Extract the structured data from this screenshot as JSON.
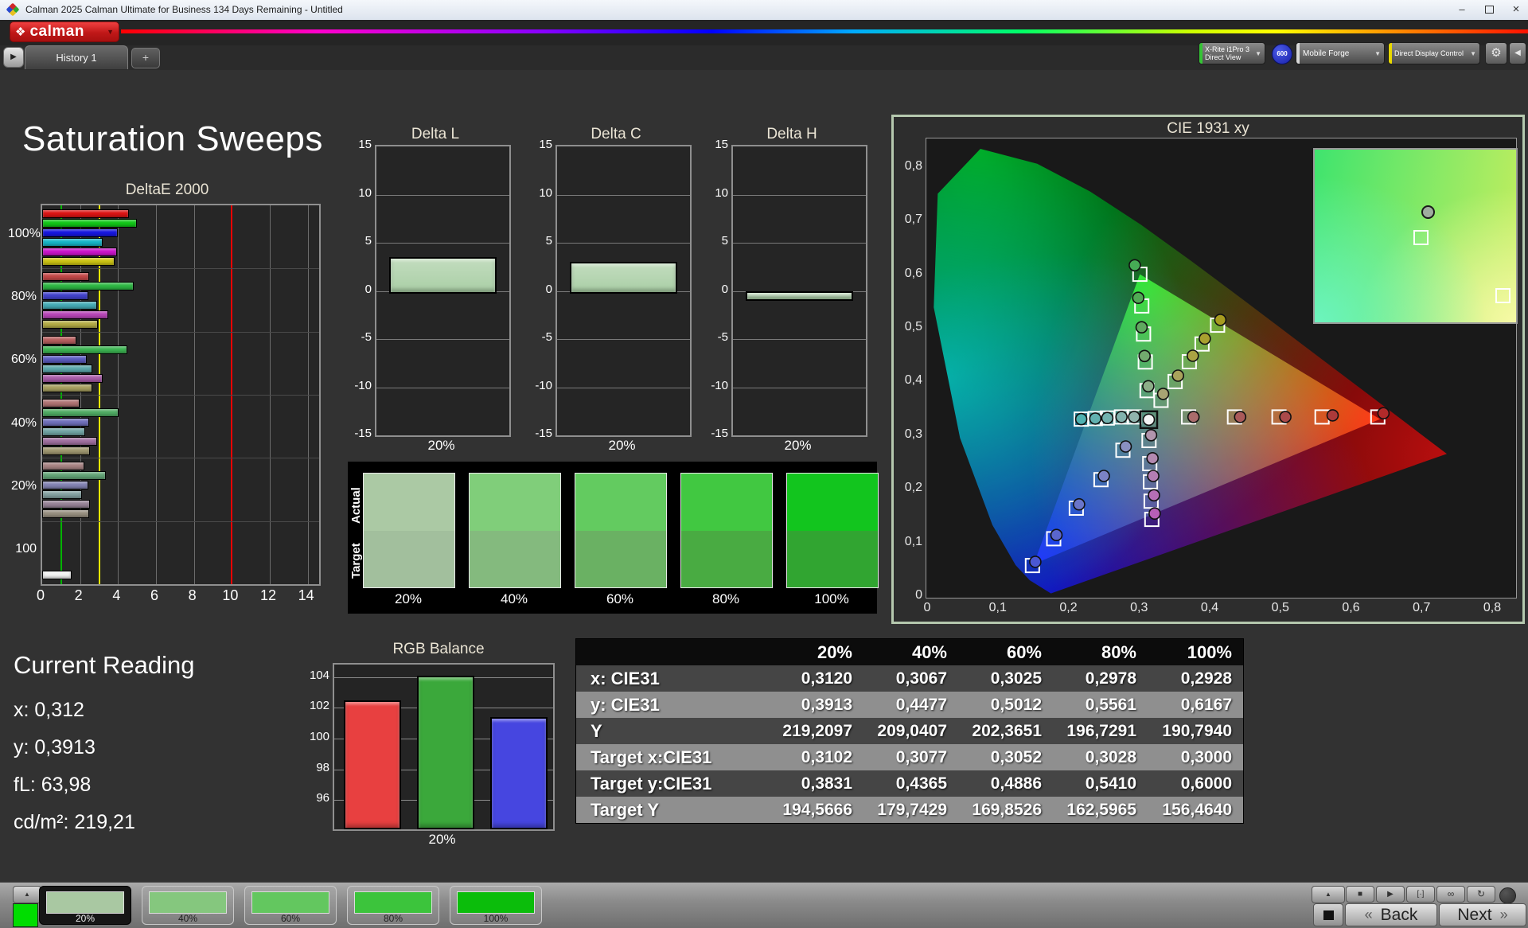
{
  "window": {
    "title": "Calman 2025 Calman Ultimate for Business 134 Days Remaining  - Untitled",
    "minimize": "–",
    "close": "×",
    "icons": [
      "app-icon",
      "minimize",
      "maximize",
      "close"
    ]
  },
  "brand": {
    "name": "calman",
    "diamond": "❖",
    "dropdown": "▼"
  },
  "toolbar": {
    "history_play": "▶",
    "tab": "History 1",
    "add": "+",
    "meter": {
      "line1": "X-Rite i1Pro 3",
      "line2": "Direct View",
      "accent": "#35c435"
    },
    "badge": "600",
    "source": {
      "label": "Mobile Forge",
      "accent": "#d8d8d8"
    },
    "control": {
      "label": "Direct Display Control",
      "accent": "#e8d800"
    },
    "gear": "⚙",
    "collapse": "◀"
  },
  "page": {
    "title": "Saturation Sweeps"
  },
  "current_reading": {
    "title": "Current Reading",
    "x": "x: 0,312",
    "y": "y: 0,3913",
    "fl": "fL: 63,98",
    "cdm2": "cd/m²: 219,21"
  },
  "swatch_compare": {
    "row_labels": [
      "Actual",
      "Target"
    ],
    "labels": [
      "20%",
      "40%",
      "60%",
      "80%",
      "100%"
    ],
    "actual": [
      "#abc9a4",
      "#80ce7a",
      "#63cb60",
      "#41c841",
      "#12c51e"
    ],
    "target": [
      "#a2bf9d",
      "#84ba7e",
      "#6ab163",
      "#49ab42",
      "#31a531"
    ]
  },
  "table": {
    "col_headers": [
      "",
      "20%",
      "40%",
      "60%",
      "80%",
      "100%"
    ],
    "rows": [
      {
        "label": "x: CIE31",
        "values": [
          "0,3120",
          "0,3067",
          "0,3025",
          "0,2978",
          "0,2928"
        ]
      },
      {
        "label": "y: CIE31",
        "values": [
          "0,3913",
          "0,4477",
          "0,5012",
          "0,5561",
          "0,6167"
        ]
      },
      {
        "label": "Y",
        "values": [
          "219,2097",
          "209,0407",
          "202,3651",
          "196,7291",
          "190,7940"
        ]
      },
      {
        "label": "Target x:CIE31",
        "values": [
          "0,3102",
          "0,3077",
          "0,3052",
          "0,3028",
          "0,3000"
        ]
      },
      {
        "label": "Target y:CIE31",
        "values": [
          "0,3831",
          "0,4365",
          "0,4886",
          "0,5410",
          "0,6000"
        ]
      },
      {
        "label": "Target Y",
        "values": [
          "194,5666",
          "179,7429",
          "169,8526",
          "162,5965",
          "156,4640"
        ]
      }
    ],
    "dark_row_bg": "#454545",
    "light_row_bg": "#8f8f8f",
    "header_bg": "#0c0c0c"
  },
  "bottom": {
    "up": "▲",
    "sample_color": "#00dd00",
    "swatches": [
      {
        "label": "20%",
        "color": "#a9c8a2",
        "selected": true
      },
      {
        "label": "40%",
        "color": "#85c77e",
        "selected": false
      },
      {
        "label": "60%",
        "color": "#63c75f",
        "selected": false
      },
      {
        "label": "80%",
        "color": "#3cc43c",
        "selected": false
      },
      {
        "label": "100%",
        "color": "#0bbd0b",
        "selected": false
      }
    ],
    "transport": [
      "■",
      "▶",
      "[·]",
      "∞",
      "↻"
    ],
    "back": "Back",
    "next": "Next",
    "back_chev": "«",
    "next_chev": "»"
  },
  "chart_data": [
    {
      "id": "deltae2000",
      "type": "bar",
      "orientation": "horizontal",
      "title": "DeltaE 2000",
      "groups": [
        "100%",
        "80%",
        "60%",
        "40%",
        "20%",
        "100"
      ],
      "series_labels": [
        "red",
        "green",
        "blue",
        "cyan",
        "magenta",
        "yellow"
      ],
      "values": [
        [
          4.5,
          4.9,
          3.9,
          3.1,
          3.85,
          3.75
        ],
        [
          2.4,
          4.75,
          2.35,
          2.8,
          3.4,
          2.85
        ],
        [
          1.7,
          4.4,
          2.25,
          2.55,
          3.1,
          2.55
        ],
        [
          1.9,
          3.95,
          2.4,
          2.2,
          2.8,
          2.45
        ],
        [
          2.15,
          3.25,
          2.35,
          2.0,
          2.45,
          2.4
        ],
        [
          1.45
        ]
      ],
      "colors": [
        [
          "#dc1414",
          "#12c818",
          "#1616e0",
          "#16b6c8",
          "#cc14cc",
          "#ccc414"
        ],
        [
          "#c44848",
          "#2eb844",
          "#4242cc",
          "#46acb6",
          "#b846b8",
          "#b4ac46"
        ],
        [
          "#b86060",
          "#3cb452",
          "#5c5cc0",
          "#5ca8ac",
          "#a85ca8",
          "#a8a060"
        ],
        [
          "#b07474",
          "#50ac64",
          "#7070bc",
          "#70a4a4",
          "#a070a0",
          "#a09870"
        ],
        [
          "#a88484",
          "#62a476",
          "#8484b4",
          "#84a0a0",
          "#988498",
          "#989080"
        ],
        [
          "#f2f2f2"
        ]
      ],
      "xlim": [
        0,
        14.6
      ],
      "xticks": [
        0,
        2,
        4,
        6,
        8,
        10,
        12,
        14
      ],
      "ref_lines": [
        {
          "x": 1,
          "color": "#00b400"
        },
        {
          "x": 3,
          "color": "#f0f000"
        },
        {
          "x": 10,
          "color": "#e80000"
        }
      ]
    },
    {
      "id": "deltaL",
      "type": "bar",
      "title": "Delta L",
      "categories": [
        "20%"
      ],
      "values": [
        3.5
      ],
      "ylim": [
        -15,
        15
      ],
      "yticks": [
        15,
        10,
        5,
        0,
        -5,
        -10,
        -15
      ],
      "bar_color": "#aacfa6"
    },
    {
      "id": "deltaC",
      "type": "bar",
      "title": "Delta C",
      "categories": [
        "20%"
      ],
      "values": [
        3.0
      ],
      "ylim": [
        -15,
        15
      ],
      "yticks": [
        15,
        10,
        5,
        0,
        -5,
        -10,
        -15
      ],
      "bar_color": "#aacfa6"
    },
    {
      "id": "deltaH",
      "type": "bar",
      "title": "Delta H",
      "categories": [
        "20%"
      ],
      "values": [
        -0.7
      ],
      "ylim": [
        -15,
        15
      ],
      "yticks": [
        15,
        10,
        5,
        0,
        -5,
        -10,
        -15
      ],
      "bar_color": "#aacfa6"
    },
    {
      "id": "rgb_balance",
      "type": "bar",
      "title": "RGB Balance",
      "categories": [
        "20%"
      ],
      "series": [
        {
          "name": "Red",
          "value": 102.5,
          "color": "#e84040"
        },
        {
          "name": "Green",
          "value": 104.1,
          "color": "#3ba83b"
        },
        {
          "name": "Blue",
          "value": 101.4,
          "color": "#4646e0"
        }
      ],
      "ylim": [
        94.1,
        104.8
      ],
      "yticks": [
        96,
        98,
        100,
        102,
        104
      ]
    },
    {
      "id": "cie1931",
      "type": "scatter",
      "title": "CIE 1931 xy",
      "xlim": [
        0,
        0.835
      ],
      "ylim": [
        0,
        0.855
      ],
      "xtick_labels": [
        "0",
        "0,1",
        "0,2",
        "0,3",
        "0,4",
        "0,5",
        "0,6",
        "0,7",
        "0,8"
      ],
      "ytick_labels": [
        "0",
        "0,1",
        "0,2",
        "0,3",
        "0,4",
        "0,5",
        "0,6",
        "0,7",
        "0,8"
      ],
      "gamut_vertices": [
        [
          0.64,
          0.33
        ],
        [
          0.3,
          0.6
        ],
        [
          0.15,
          0.06
        ]
      ],
      "white_point": {
        "x": 0.3127,
        "y": 0.329
      },
      "measured": [
        {
          "x": 0.2928,
          "y": 0.6167,
          "color": "#46ab55"
        },
        {
          "x": 0.2978,
          "y": 0.5561,
          "color": "#51aa55"
        },
        {
          "x": 0.3025,
          "y": 0.5012,
          "color": "#5fa95f"
        },
        {
          "x": 0.3067,
          "y": 0.4477,
          "color": "#72aa6e"
        },
        {
          "x": 0.312,
          "y": 0.3913,
          "color": "#8cae88"
        },
        {
          "x": 0.333,
          "y": 0.377,
          "color": "#a7a473"
        },
        {
          "x": 0.354,
          "y": 0.411,
          "color": "#a9a35b"
        },
        {
          "x": 0.375,
          "y": 0.448,
          "color": "#aaa343"
        },
        {
          "x": 0.392,
          "y": 0.48,
          "color": "#a9a02f"
        },
        {
          "x": 0.414,
          "y": 0.515,
          "color": "#a79c1f"
        },
        {
          "x": 0.376,
          "y": 0.334,
          "color": "#aa6c6c"
        },
        {
          "x": 0.442,
          "y": 0.334,
          "color": "#aa5a5a"
        },
        {
          "x": 0.506,
          "y": 0.334,
          "color": "#ab4a4a"
        },
        {
          "x": 0.573,
          "y": 0.337,
          "color": "#ac3a3a"
        },
        {
          "x": 0.645,
          "y": 0.341,
          "color": "#b22a2a"
        },
        {
          "x": 0.292,
          "y": 0.334,
          "color": "#90b4ad"
        },
        {
          "x": 0.274,
          "y": 0.334,
          "color": "#82b3ae"
        },
        {
          "x": 0.254,
          "y": 0.332,
          "color": "#72b2af"
        },
        {
          "x": 0.237,
          "y": 0.331,
          "color": "#61b1b0"
        },
        {
          "x": 0.217,
          "y": 0.33,
          "color": "#4eb1b1"
        },
        {
          "x": 0.316,
          "y": 0.3,
          "color": "#b295ad"
        },
        {
          "x": 0.318,
          "y": 0.257,
          "color": "#b389b0"
        },
        {
          "x": 0.319,
          "y": 0.224,
          "color": "#b47db3"
        },
        {
          "x": 0.32,
          "y": 0.188,
          "color": "#b56fb5"
        },
        {
          "x": 0.321,
          "y": 0.154,
          "color": "#b75fb7"
        },
        {
          "x": 0.28,
          "y": 0.279,
          "color": "#8a90c2"
        },
        {
          "x": 0.249,
          "y": 0.224,
          "color": "#7b83c6"
        },
        {
          "x": 0.214,
          "y": 0.171,
          "color": "#6a75ca"
        },
        {
          "x": 0.182,
          "y": 0.114,
          "color": "#5a66ce"
        },
        {
          "x": 0.152,
          "y": 0.064,
          "color": "#4a57d2"
        }
      ],
      "targets": [
        {
          "x": 0.3,
          "y": 0.6
        },
        {
          "x": 0.3028,
          "y": 0.541
        },
        {
          "x": 0.3052,
          "y": 0.4886
        },
        {
          "x": 0.3077,
          "y": 0.4365
        },
        {
          "x": 0.3102,
          "y": 0.3831
        },
        {
          "x": 0.33,
          "y": 0.365
        },
        {
          "x": 0.35,
          "y": 0.4
        },
        {
          "x": 0.37,
          "y": 0.437
        },
        {
          "x": 0.388,
          "y": 0.47
        },
        {
          "x": 0.41,
          "y": 0.505
        },
        {
          "x": 0.369,
          "y": 0.334
        },
        {
          "x": 0.434,
          "y": 0.334
        },
        {
          "x": 0.497,
          "y": 0.334
        },
        {
          "x": 0.558,
          "y": 0.334
        },
        {
          "x": 0.637,
          "y": 0.334
        },
        {
          "x": 0.292,
          "y": 0.334
        },
        {
          "x": 0.274,
          "y": 0.334
        },
        {
          "x": 0.254,
          "y": 0.332
        },
        {
          "x": 0.237,
          "y": 0.331
        },
        {
          "x": 0.217,
          "y": 0.33
        },
        {
          "x": 0.313,
          "y": 0.29
        },
        {
          "x": 0.314,
          "y": 0.247
        },
        {
          "x": 0.315,
          "y": 0.213
        },
        {
          "x": 0.316,
          "y": 0.177
        },
        {
          "x": 0.317,
          "y": 0.143
        },
        {
          "x": 0.276,
          "y": 0.272
        },
        {
          "x": 0.245,
          "y": 0.217
        },
        {
          "x": 0.21,
          "y": 0.164
        },
        {
          "x": 0.178,
          "y": 0.107
        },
        {
          "x": 0.148,
          "y": 0.057
        }
      ],
      "inset_markers": [
        {
          "type": "circle",
          "x": 56,
          "y": 36
        },
        {
          "type": "square",
          "x": 52,
          "y": 50
        },
        {
          "type": "square",
          "x": 93,
          "y": 84
        }
      ]
    }
  ]
}
